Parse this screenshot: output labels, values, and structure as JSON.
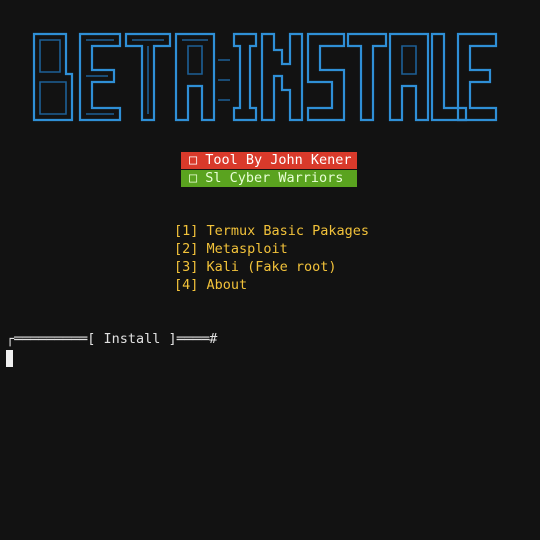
{
  "banner": {
    "text": "BETA INSTALLER",
    "color": "#2f8fd6"
  },
  "badges": [
    {
      "label": "□ Tool By John Kener",
      "bg": "#d93a2b"
    },
    {
      "label": "□ Sl Cyber Warriors",
      "bg": "#5aa31f"
    }
  ],
  "menu": [
    {
      "label": "[1] Termux Basic Pakages"
    },
    {
      "label": "[2] Metasploit"
    },
    {
      "label": "[3] Kali (Fake root)"
    },
    {
      "label": "[4] About"
    }
  ],
  "prompt": {
    "text": "┌═════════[ Install ]════#"
  },
  "colors": {
    "background": "#121212",
    "menu": "#f2c23a"
  }
}
